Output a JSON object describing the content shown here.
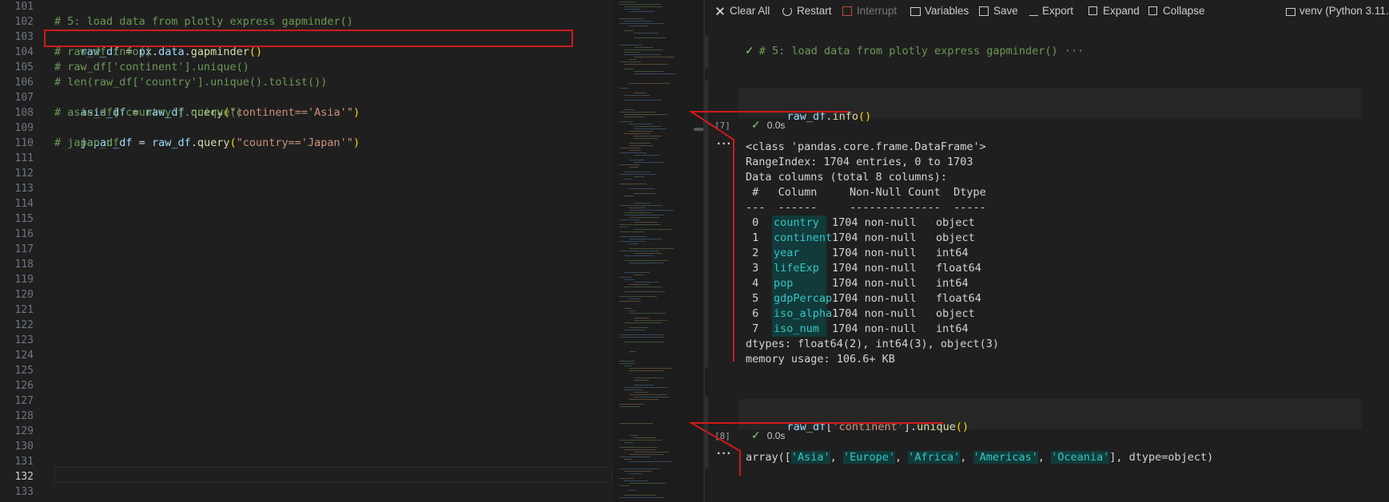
{
  "editor": {
    "line_numbers": [
      "101",
      "102",
      "103",
      "104",
      "105",
      "106",
      "107",
      "108",
      "109",
      "110",
      "111",
      "112",
      "113",
      "114",
      "115",
      "116",
      "117",
      "118",
      "119",
      "120",
      "121",
      "122",
      "123",
      "124",
      "125",
      "126",
      "127",
      "128",
      "129",
      "130",
      "131",
      "132",
      "133"
    ],
    "active_line": "132",
    "lines": {
      "l102": "# 5: load data from plotly express gapminder()",
      "l103": {
        "a": "raw_df",
        "b": " = ",
        "c": "px",
        "d": ".",
        "e": "data",
        "f": ".",
        "g": "gapminder",
        "h": "()"
      },
      "l104": "# raw_df.info()",
      "l105": "# raw_df['continent'].unique()",
      "l106": "# len(raw_df['country'].unique().tolist())",
      "l107": {
        "a": "asia_df",
        "b": " = ",
        "c": "raw_df",
        "d": ".",
        "e": "query",
        "f": "(",
        "g": "\"continent=='Asia'\"",
        "h": ")"
      },
      "l108": "# asia_df['country'].unique()",
      "l109": {
        "a": "japan_df",
        "b": " = ",
        "c": "raw_df",
        "d": ".",
        "e": "query",
        "f": "(",
        "g": "\"country=='Japan'\"",
        "h": ")"
      },
      "l110": "# japan_df"
    }
  },
  "toolbar": {
    "clear_all": "Clear All",
    "restart": "Restart",
    "interrupt": "Interrupt",
    "variables": "Variables",
    "save": "Save",
    "export": "Export",
    "expand": "Expand",
    "collapse": "Collapse",
    "kernel": "venv (Python 3.11."
  },
  "notebook": {
    "markdown_cell": "# 5: load data from plotly express gapminder() ···",
    "cell1": {
      "source_a": "raw_df",
      "source_b": ".",
      "source_c": "info",
      "source_d": "()",
      "exec_count": "[7]",
      "duration": "0.0s",
      "ellipsis": "···",
      "output_lines": [
        "<class 'pandas.core.frame.DataFrame'>",
        "RangeIndex: 1704 entries, 0 to 1703",
        "Data columns (total 8 columns):",
        " #   Column     Non-Null Count  Dtype  ",
        "---  ------     --------------  -----  "
      ],
      "rows": [
        {
          "idx": " 0",
          "col": "country",
          "rest": "1704 non-null   object "
        },
        {
          "idx": " 1",
          "col": "continent",
          "rest": "1704 non-null   object "
        },
        {
          "idx": " 2",
          "col": "year",
          "rest": "1704 non-null   int64  "
        },
        {
          "idx": " 3",
          "col": "lifeExp",
          "rest": "1704 non-null   float64"
        },
        {
          "idx": " 4",
          "col": "pop",
          "rest": "1704 non-null   int64  "
        },
        {
          "idx": " 5",
          "col": "gdpPercap",
          "rest": "1704 non-null   float64"
        },
        {
          "idx": " 6",
          "col": "iso_alpha",
          "rest": "1704 non-null   object "
        },
        {
          "idx": " 7",
          "col": "iso_num",
          "rest": "1704 non-null   int64  "
        }
      ],
      "footer_lines": [
        "dtypes: float64(2), int64(3), object(3)",
        "memory usage: 106.6+ KB"
      ]
    },
    "cell2": {
      "source_a": "raw_df",
      "source_b": "[",
      "source_c": "'continent'",
      "source_d": "].",
      "source_e": "unique",
      "source_f": "()",
      "exec_count": "[8]",
      "duration": "0.0s",
      "ellipsis": "···",
      "out_a": "array([",
      "out_items": [
        "'Asia'",
        "'Europe'",
        "'Africa'",
        "'Americas'",
        "'Oceania'"
      ],
      "out_sep": ", ",
      "out_end": "], dtype=object)"
    }
  },
  "colors": {
    "annotation_red": "#d11a1a",
    "comment_green": "#6a9955",
    "teal": "#34c6c6"
  }
}
